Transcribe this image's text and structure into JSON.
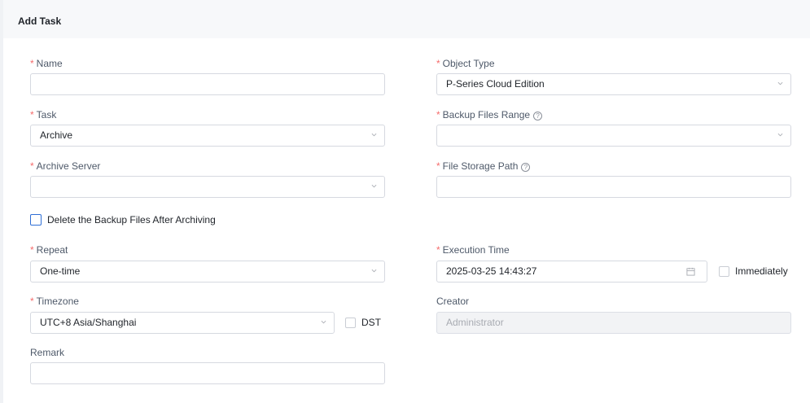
{
  "header": {
    "title": "Add Task"
  },
  "form": {
    "name": {
      "label": "Name",
      "value": ""
    },
    "object_type": {
      "label": "Object Type",
      "value": "P-Series Cloud Edition"
    },
    "task": {
      "label": "Task",
      "value": "Archive"
    },
    "backup_files_range": {
      "label": "Backup Files Range",
      "value": ""
    },
    "archive_server": {
      "label": "Archive Server",
      "value": ""
    },
    "file_storage_path": {
      "label": "File Storage Path",
      "value": ""
    },
    "delete_backup": {
      "label": "Delete the Backup Files After Archiving",
      "checked": false
    },
    "repeat": {
      "label": "Repeat",
      "value": "One-time"
    },
    "execution_time": {
      "label": "Execution Time",
      "value": "2025-03-25 14:43:27"
    },
    "immediately": {
      "label": "Immediately",
      "checked": false
    },
    "timezone": {
      "label": "Timezone",
      "value": "UTC+8 Asia/Shanghai"
    },
    "dst": {
      "label": "DST",
      "checked": false
    },
    "creator": {
      "label": "Creator",
      "value": "Administrator"
    },
    "remark": {
      "label": "Remark",
      "value": ""
    },
    "required_mark": "*",
    "help_glyph": "?"
  },
  "icons": {
    "dropdown": "chevron-down-icon",
    "help": "question-circle-icon",
    "calendar": "calendar-icon"
  },
  "colors": {
    "required": "#f56c6c",
    "checkbox_accent": "#2f6fd6",
    "border": "#d6d9e0",
    "disabled_bg": "#f2f3f5"
  }
}
